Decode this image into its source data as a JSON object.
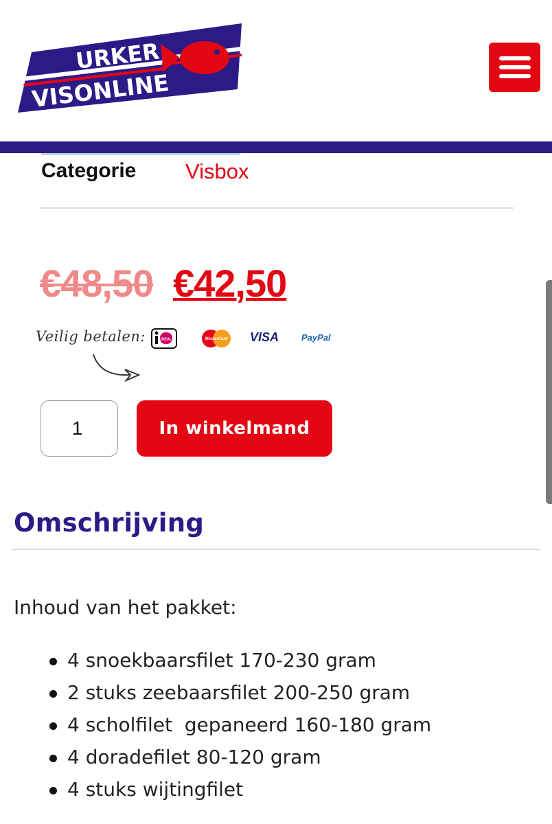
{
  "header": {
    "logo_line1": "URKER",
    "logo_line2": "VISONLINE",
    "menu_icon": "hamburger-icon",
    "colors": {
      "brand_purple": "#2e1a87",
      "brand_red": "#e30613"
    }
  },
  "product": {
    "category_label": "Categorie",
    "category_value": "Visbox",
    "price_old": "€48,50",
    "price_new": "€42,50"
  },
  "payment": {
    "label": "Veilig betalen:",
    "methods": [
      "iDEAL",
      "MasterCard",
      "VISA",
      "PayPal"
    ]
  },
  "cart": {
    "quantity": "1",
    "button_label": "In winkelmand"
  },
  "description": {
    "heading": "Omschrijving",
    "intro": "Inhoud van het pakket:",
    "items": [
      "4 snoekbaarsfilet 170-230 gram",
      "2 stuks zeebaarsfilet 200-250 gram",
      "4 scholfilet  gepaneerd 160-180 gram",
      "4 doradefilet 80-120 gram",
      "4 stuks wijtingfilet"
    ]
  }
}
